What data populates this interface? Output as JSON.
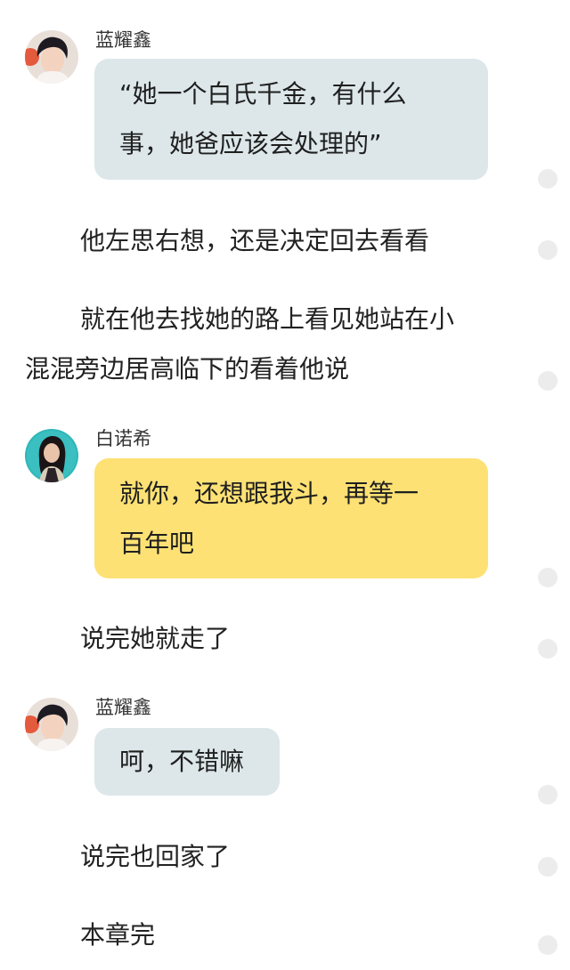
{
  "messages": [
    {
      "speaker": "蓝耀鑫",
      "lines": [
        "“她一个白氏千金，有什么",
        "事，她爸应该会处理的”"
      ]
    },
    {
      "narration": [
        "他左思右想，还是决定回去看看"
      ]
    },
    {
      "narration": [
        "就在他去找她的路上看见她站在小",
        "混混旁边居高临下的看着他说"
      ]
    },
    {
      "speaker": "白诺希",
      "lines": [
        "就你，还想跟我斗，再等一",
        "百年吧"
      ]
    },
    {
      "narration": [
        "说完她就走了"
      ]
    },
    {
      "speaker": "蓝耀鑫",
      "lines": [
        "呵，不错嘛"
      ]
    },
    {
      "narration": [
        "说完也回家了"
      ]
    },
    {
      "narration": [
        "本章完"
      ]
    }
  ],
  "colors": {
    "bubble_male": "#dde7ea",
    "bubble_female": "#fde174",
    "comment_dot": "#ececec"
  },
  "icons": [
    "avatar-male",
    "avatar-female",
    "comment-dot-icon"
  ]
}
